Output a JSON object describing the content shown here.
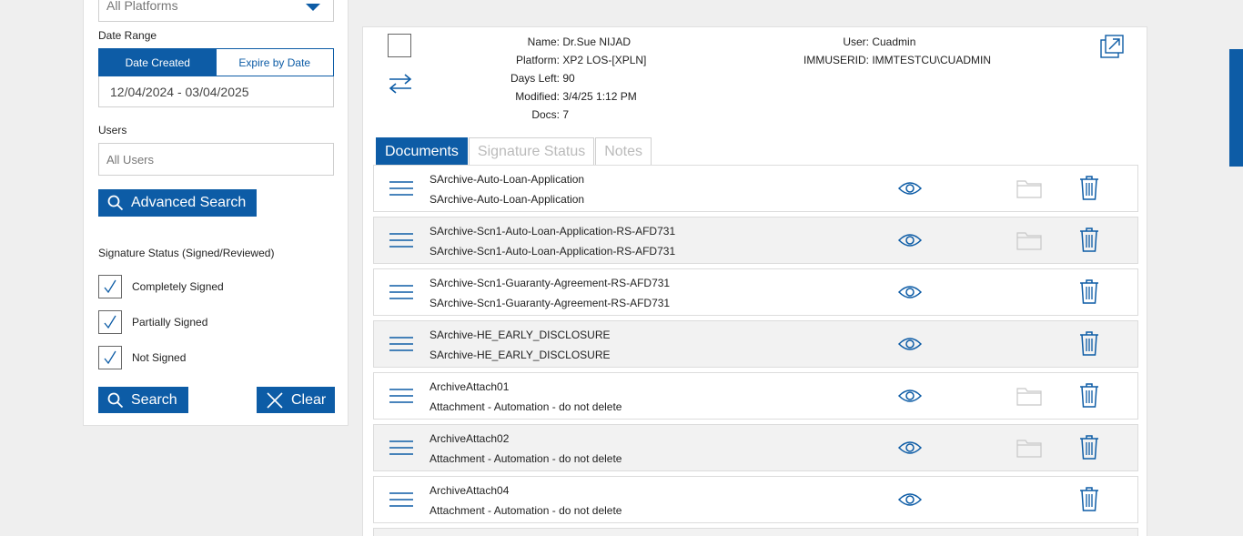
{
  "filters": {
    "platform_value": "All Platforms",
    "date_range_label": "Date Range",
    "date_tabs": [
      "Date Created",
      "Expire by Date"
    ],
    "date_range_value": "12/04/2024 - 03/04/2025",
    "users_label": "Users",
    "users_value": "All Users",
    "advanced_search_label": "Advanced Search",
    "signature_status_label": "Signature Status (Signed/Reviewed)",
    "checkboxes": [
      {
        "label": "Completely Signed",
        "checked": true
      },
      {
        "label": "Partially Signed",
        "checked": true
      },
      {
        "label": "Not Signed",
        "checked": true
      }
    ],
    "search_label": "Search",
    "clear_label": "Clear"
  },
  "record": {
    "name_key": "Name:",
    "name_val": "Dr.Sue NIJAD",
    "platform_key": "Platform:",
    "platform_val": "XP2 LOS-[XPLN]",
    "days_left_key": "Days Left:",
    "days_left_val": "90",
    "modified_key": "Modified:",
    "modified_val": "3/4/25 1:12 PM",
    "docs_key": "Docs:",
    "docs_val": "7",
    "user_key": "User:",
    "user_val": "Cuadmin",
    "immuserid_key": "IMMUSERID:",
    "immuserid_val": "IMMTESTCU\\CUADMIN"
  },
  "tabs": [
    "Documents",
    "Signature Status",
    "Notes"
  ],
  "documents": [
    {
      "title": "SArchive-Auto-Loan-Application",
      "subtitle": "SArchive-Auto-Loan-Application",
      "has_folder": true
    },
    {
      "title": "SArchive-Scn1-Auto-Loan-Application-RS-AFD731",
      "subtitle": "SArchive-Scn1-Auto-Loan-Application-RS-AFD731",
      "has_folder": true
    },
    {
      "title": "SArchive-Scn1-Guaranty-Agreement-RS-AFD731",
      "subtitle": "SArchive-Scn1-Guaranty-Agreement-RS-AFD731",
      "has_folder": false
    },
    {
      "title": "SArchive-HE_EARLY_DISCLOSURE",
      "subtitle": "SArchive-HE_EARLY_DISCLOSURE",
      "has_folder": false
    },
    {
      "title": "ArchiveAttach01",
      "subtitle": "Attachment - Automation - do not delete",
      "has_folder": true
    },
    {
      "title": "ArchiveAttach02",
      "subtitle": "Attachment - Automation - do not delete",
      "has_folder": true
    },
    {
      "title": "ArchiveAttach04",
      "subtitle": "Attachment - Automation - do not delete",
      "has_folder": false
    }
  ],
  "icons": [
    "caret-down-icon",
    "search-icon",
    "close-icon",
    "checkmark-icon",
    "swap-icon",
    "popout-icon",
    "menu-icon",
    "eye-icon",
    "folder-icon",
    "trash-icon"
  ],
  "colors": {
    "accent": "#0d5ca6"
  }
}
